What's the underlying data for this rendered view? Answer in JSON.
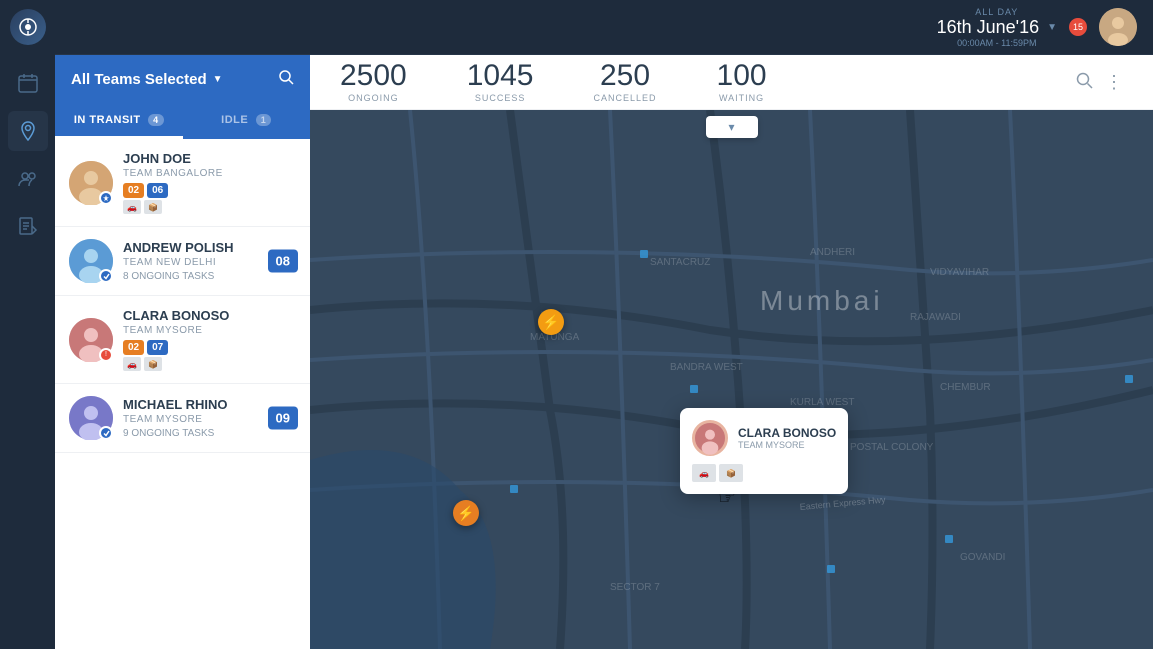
{
  "app": {
    "logo": "✦"
  },
  "topnav": {
    "date_label": "ALL DAY",
    "date_value": "16th June'16",
    "time_range": "00:00AM - 11:59PM",
    "notification_count": "15"
  },
  "sidebar": {
    "items": [
      {
        "icon": "📅",
        "name": "calendar",
        "active": false
      },
      {
        "icon": "📍",
        "name": "location",
        "active": true
      },
      {
        "icon": "👥",
        "name": "teams",
        "active": false
      }
    ]
  },
  "panel": {
    "title": "All Teams Selected",
    "tabs": [
      {
        "label": "IN TRANSIT",
        "count": "4",
        "active": true
      },
      {
        "label": "IDLE",
        "count": "1",
        "active": false
      }
    ],
    "agents": [
      {
        "name": "JOHN DOE",
        "team": "TEAM BANGALORE",
        "badge1": "02",
        "badge2": "06",
        "badge_color1": "orange",
        "badge_color2": "blue",
        "has_icons": true,
        "avatar_style": "p1"
      },
      {
        "name": "ANDREW POLISH",
        "team": "TEAM NEW DELHI",
        "tasks": "8 ONGOING TASKS",
        "count": "08",
        "badge_color": "blue",
        "has_icons": false,
        "avatar_style": "p2"
      },
      {
        "name": "CLARA BONOSO",
        "team": "TEAM MYSORE",
        "badge1": "02",
        "badge2": "07",
        "badge_color1": "orange",
        "badge_color2": "blue",
        "has_icons": true,
        "avatar_style": "p3"
      },
      {
        "name": "MICHAEL RHINO",
        "team": "TEAM MYSORE",
        "tasks": "9 ONGOING TASKS",
        "count": "09",
        "badge_color": "blue",
        "has_icons": false,
        "avatar_style": "p4"
      }
    ]
  },
  "stats": [
    {
      "number": "2500",
      "label": "ONGOING"
    },
    {
      "number": "1045",
      "label": "SUCCESS"
    },
    {
      "number": "250",
      "label": "CANCELLED"
    },
    {
      "number": "100",
      "label": "WAITING"
    }
  ],
  "popup": {
    "name": "CLARA BONOSO",
    "team": "TEAM MYSORE",
    "badge1": "▣",
    "badge2": "▣"
  },
  "map": {
    "city": "Mumbai"
  }
}
